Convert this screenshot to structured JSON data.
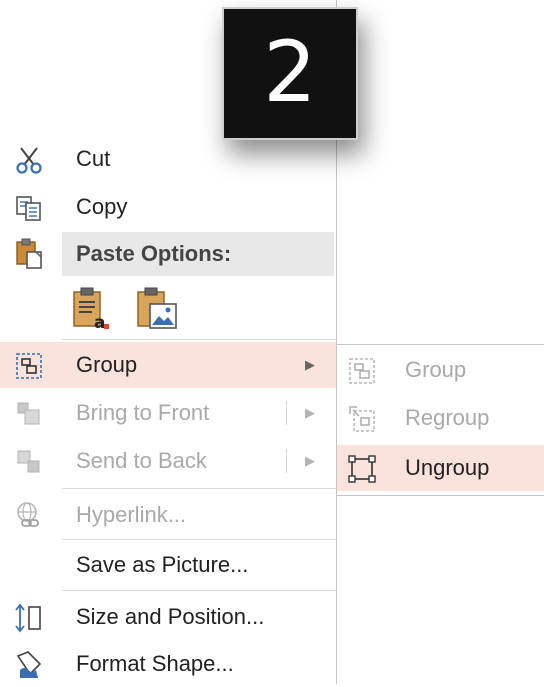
{
  "badge": {
    "text": "2"
  },
  "colors": {
    "hover": "#fbe3dd",
    "accent": "#e2472b",
    "disabled": "#a9a9a9"
  },
  "menu": {
    "items": [
      {
        "label": "Cut",
        "icon": "scissors-icon",
        "enabled": true
      },
      {
        "label": "Copy",
        "icon": "copy-icon",
        "enabled": true
      },
      {
        "label": "Group",
        "icon": "group-icon",
        "enabled": true,
        "submenu": true,
        "highlighted": true
      },
      {
        "label": "Bring to Front",
        "icon": "bring-to-front-icon",
        "enabled": false,
        "submenu": true
      },
      {
        "label": "Send to Back",
        "icon": "send-to-back-icon",
        "enabled": false,
        "submenu": true
      },
      {
        "label": "Hyperlink...",
        "icon": "hyperlink-icon",
        "enabled": false
      },
      {
        "label": "Save as Picture...",
        "enabled": true
      },
      {
        "label": "Size and Position...",
        "icon": "size-position-icon",
        "enabled": true
      },
      {
        "label": "Format Shape...",
        "icon": "format-shape-icon",
        "enabled": true
      }
    ],
    "paste": {
      "header": "Paste Options:",
      "icon": "paste-icon",
      "options": [
        {
          "icon": "paste-keep-text-icon"
        },
        {
          "icon": "paste-picture-icon"
        }
      ]
    }
  },
  "group_submenu": {
    "items": [
      {
        "label": "Group",
        "icon": "group-icon",
        "enabled": false
      },
      {
        "label": "Regroup",
        "icon": "regroup-icon",
        "enabled": false
      },
      {
        "label": "Ungroup",
        "icon": "ungroup-icon",
        "enabled": true,
        "highlighted": true
      }
    ]
  }
}
